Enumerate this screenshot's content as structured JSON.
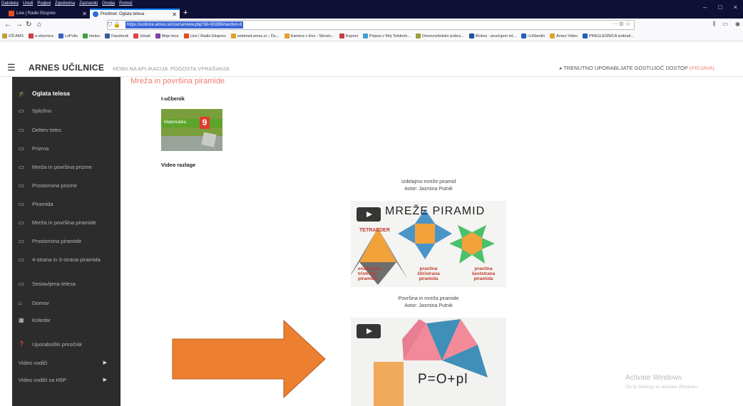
{
  "browser": {
    "menu": [
      "Datoteka",
      "Uredi",
      "Pogled",
      "Zgodovina",
      "Zaznamki",
      "Orodja",
      "Pomoč"
    ],
    "tabs": [
      {
        "title": "Live | Radio Ekspres",
        "active": false
      },
      {
        "title": "Predmet: Oglata telesa",
        "active": true
      }
    ],
    "new_tab": "+",
    "url": "https://ucilnice.arnes.si/course/view.php?id=30288#section-6",
    "url_actions": "··· ⊙ ☆",
    "window_controls": [
      "–",
      "□",
      "×"
    ],
    "bookmarks": [
      {
        "label": "OŠ AMS",
        "color": "#c0a040"
      },
      {
        "label": "e-zbornica",
        "color": "#d04040"
      },
      {
        "label": "LoPolis",
        "color": "#4060c0"
      },
      {
        "label": "meteo",
        "color": "#40a040"
      },
      {
        "label": "Facebook",
        "color": "#3b5998"
      },
      {
        "label": "Gmail",
        "color": "#d44"
      },
      {
        "label": "Moje-lece",
        "color": "#8040a0"
      },
      {
        "label": "Live | Radio Ekspres",
        "color": "#e05020"
      },
      {
        "label": "webmail.arnes.si :: Do...",
        "color": "#e0a030"
      },
      {
        "label": "Kamera v živo - Sloven...",
        "color": "#e0a030"
      },
      {
        "label": "Kuponi",
        "color": "#c04040"
      },
      {
        "label": "Prijava v Moj Telekom...",
        "color": "#40a0d0"
      },
      {
        "label": "Osnovnošolsko izobra...",
        "color": "#a0a040"
      },
      {
        "label": "iRokus - poučujem int...",
        "color": "#2050a0"
      },
      {
        "label": "i-Učbeniki",
        "color": "#2060c0"
      },
      {
        "label": "Arnes Video",
        "color": "#e0a030"
      },
      {
        "label": "PREGLEDNICA izobraž...",
        "color": "#2060c0"
      }
    ]
  },
  "header": {
    "menu_icon": "☰",
    "site_name": "ARNES UČILNICE",
    "links": [
      "MOBILNA APLIKACIJA",
      "POGOSTA VPRAŠANJA"
    ],
    "guest_text": "TRENUTNO UPORABLJATE GOSTUJOČ DOSTOP",
    "login_text": "(PRIJAVA)"
  },
  "sidebar": {
    "course_title": "Oglata telesa",
    "items": [
      {
        "label": "Splošno",
        "icon": "folder-icon"
      },
      {
        "label": "Delitev teles",
        "icon": "folder-icon"
      },
      {
        "label": "Prizma",
        "icon": "folder-icon"
      },
      {
        "label": "Mreža in površina prizme",
        "icon": "folder-icon"
      },
      {
        "label": "Prostornina prizme",
        "icon": "folder-icon"
      },
      {
        "label": "Piramida",
        "icon": "folder-icon"
      },
      {
        "label": "Mreža in površina piramide",
        "icon": "folder-icon"
      },
      {
        "label": "Prostornina piramide",
        "icon": "folder-icon"
      },
      {
        "label": "4-strana in 3-strana piramida",
        "icon": "folder-icon"
      },
      {
        "label": "Sestavljena telesa",
        "icon": "folder-icon"
      }
    ],
    "nav": [
      {
        "label": "Domov",
        "icon": "home-icon"
      },
      {
        "label": "Koledar",
        "icon": "calendar-icon"
      }
    ],
    "help": {
      "label": "Uporabniški priročnik",
      "icon": "question-icon"
    },
    "guides": [
      {
        "label": "Video vodiči"
      },
      {
        "label": "Video vodiči za H5P"
      }
    ]
  },
  "main": {
    "section_title": "Mreža in površina piramide",
    "textbook_label": "I-učbenik",
    "book": {
      "title": "Matematika",
      "number": "9"
    },
    "video_label": "Video razlage",
    "videos": [
      {
        "title": "Izdelajmo mreže piramid",
        "author": "Avtor: Jasmina Putnik",
        "heading": "MREŽE PIRAMID",
        "tetra": "TETRAEDER",
        "labels": [
          "enakoroba tristrana piramida",
          "pravilna štiristrana piramida",
          "pravilna šeststrana piramida"
        ]
      },
      {
        "title": "Površina in mreža piramide",
        "author": "Avtor: Jasmina Putnik",
        "formula": "P=O+pl"
      }
    ]
  },
  "watermark": {
    "title": "Activate Windows",
    "subtitle": "Go to Settings to activate Windows."
  },
  "colors": {
    "sidebar_bg": "#2c2c2c",
    "accent": "#f07a73",
    "arrow": "#ec7f30",
    "chrome": "#0f1035"
  }
}
